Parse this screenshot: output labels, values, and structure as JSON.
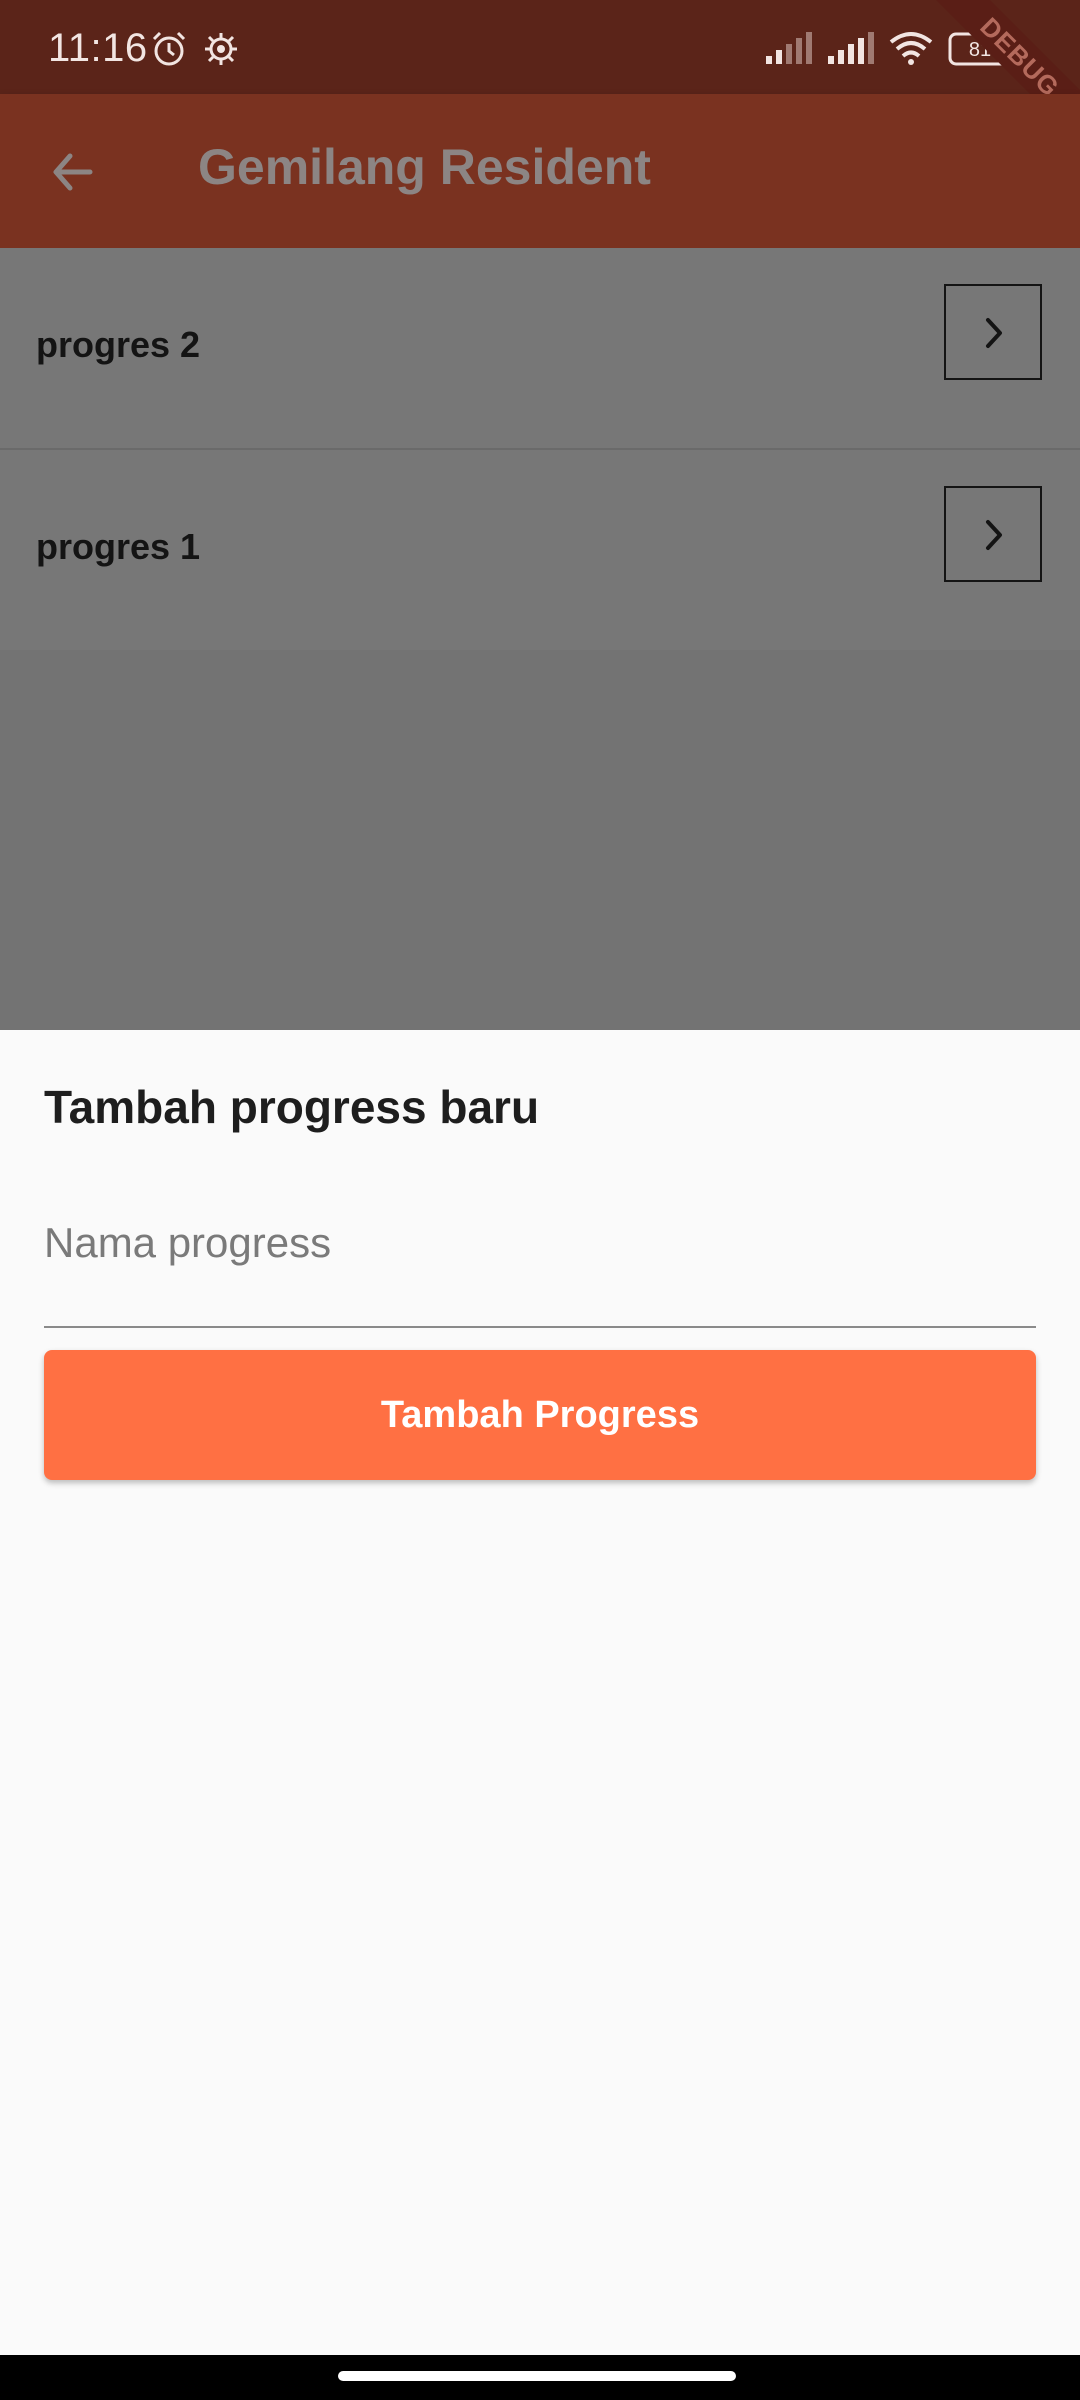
{
  "status_bar": {
    "time": "11:16",
    "battery": "81",
    "icons": [
      "alarm-icon",
      "settings-gear-icon",
      "signal-icon",
      "signal-icon",
      "wifi-icon",
      "battery-icon"
    ],
    "debug_banner": "DEBUG"
  },
  "app_bar": {
    "title": "Gemilang Resident",
    "back_icon": "arrow-back-icon",
    "color": "#7a3220"
  },
  "progress_list": [
    {
      "label": "progres 2",
      "action_icon": "chevron-right-icon"
    },
    {
      "label": "progres 1",
      "action_icon": "chevron-right-icon"
    }
  ],
  "sheet": {
    "title": "Tambah progress baru",
    "input_placeholder": "Nama progress",
    "input_value": "",
    "button_label": "Tambah Progress",
    "button_color": "#ff7043"
  }
}
